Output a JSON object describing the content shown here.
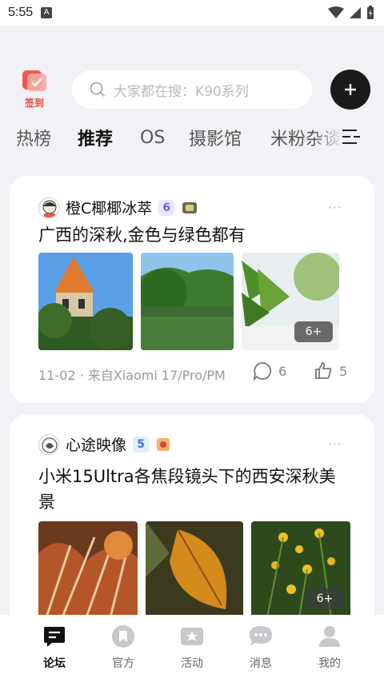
{
  "status_bar": {
    "time": "5:55",
    "notif_icon": "A"
  },
  "header": {
    "signin_label": "签到",
    "search_placeholder": "大家都在搜：K90系列",
    "add_icon": "plus-icon"
  },
  "tabs": [
    "热榜",
    "推荐",
    "OS",
    "摄影馆",
    "米粉杂谈"
  ],
  "active_tab": "推荐",
  "posts": [
    {
      "author": "橙C椰椰冰萃",
      "level": "6",
      "title": "广西的深秋,金色与绿色都有",
      "more_photos": "6+",
      "date": "11-02",
      "source": "· 来自Xiaomi 17/Pro/PM",
      "comments": "6",
      "likes": "5"
    },
    {
      "author": "心途映像",
      "level": "5",
      "title": "小米15Ultra各焦段镜头下的西安深秋美景",
      "more_photos": "6+"
    }
  ],
  "bottom_nav": [
    {
      "label": "论坛",
      "icon": "forum-icon"
    },
    {
      "label": "官方",
      "icon": "official-icon"
    },
    {
      "label": "活动",
      "icon": "activity-icon"
    },
    {
      "label": "消息",
      "icon": "message-icon"
    },
    {
      "label": "我的",
      "icon": "profile-icon"
    }
  ],
  "colors": {
    "accent_red": "#e8453c",
    "dark": "#1a1a1a",
    "bg": "#f2f2f6"
  }
}
